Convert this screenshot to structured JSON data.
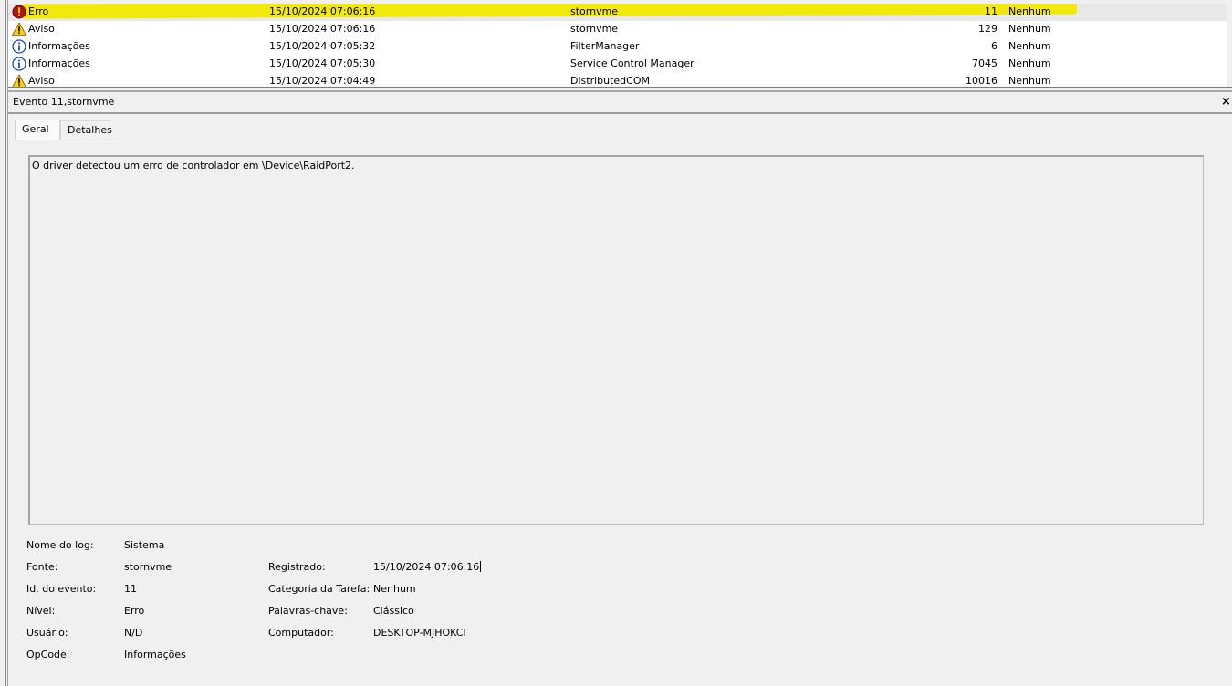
{
  "events": [
    {
      "level": "Erro",
      "icon": "error-icon",
      "date": "15/10/2024 07:06:16",
      "source": "stornvme",
      "id": "11",
      "category": "Nenhum"
    },
    {
      "level": "Aviso",
      "icon": "warning-icon",
      "date": "15/10/2024 07:06:16",
      "source": "stornvme",
      "id": "129",
      "category": "Nenhum"
    },
    {
      "level": "Informações",
      "icon": "info-icon",
      "date": "15/10/2024 07:05:32",
      "source": "FilterManager",
      "id": "6",
      "category": "Nenhum"
    },
    {
      "level": "Informações",
      "icon": "info-icon",
      "date": "15/10/2024 07:05:30",
      "source": "Service Control Manager",
      "id": "7045",
      "category": "Nenhum"
    },
    {
      "level": "Aviso",
      "icon": "warning-icon",
      "date": "15/10/2024 07:04:49",
      "source": "DistributedCOM",
      "id": "10016",
      "category": "Nenhum"
    }
  ],
  "highlight_color": "#f2e900",
  "pane": {
    "title": "Evento 11,stornvme",
    "close": "×",
    "tabs": [
      "Geral",
      "Detalhes"
    ],
    "message": "O driver detectou um erro de controlador em \\Device\\RaidPort2."
  },
  "props": {
    "log_name_label": "Nome do log:",
    "log_name": "Sistema",
    "source_label": "Fonte:",
    "source": "stornvme",
    "logged_label": "Registrado:",
    "logged": "15/10/2024 07:06:16",
    "event_id_label": "Id. do evento:",
    "event_id": "11",
    "task_label": "Categoria da Tarefa:",
    "task": "Nenhum",
    "level_label": "Nível:",
    "level": "Erro",
    "keywords_label": "Palavras-chave:",
    "keywords": "Clássico",
    "user_label": "Usuário:",
    "user": "N/D",
    "computer_label": "Computador:",
    "computer": "DESKTOP-MJHOKCI",
    "opcode_label": "OpCode:",
    "opcode": "Informações"
  }
}
